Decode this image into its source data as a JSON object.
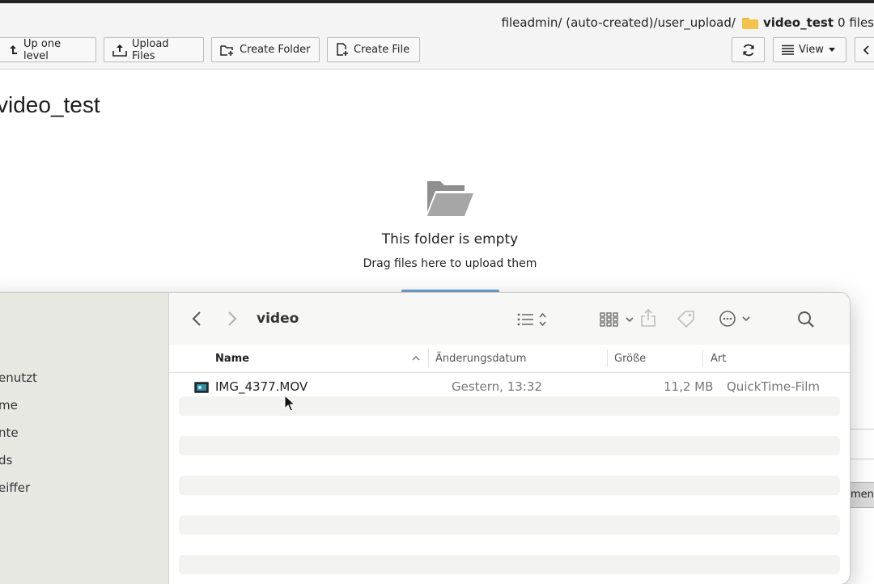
{
  "breadcrumb": {
    "path_prefix": "fileadmin/ (auto-created)/user_upload/",
    "current_folder": "video_test",
    "file_count": "0 files"
  },
  "toolbar": {
    "up_label": "Up one level",
    "upload_label": "Upload Files",
    "create_folder_label": "Create Folder",
    "create_file_label": "Create File",
    "view_label": "View"
  },
  "page": {
    "title": "video_test",
    "empty_title": "This folder is empty",
    "empty_subtitle": "Drag files here to upload them",
    "partial_button_text": "ment"
  },
  "finder": {
    "folder_title": "video",
    "sidebar_items": [
      "enutzt",
      "me",
      "nte",
      "ds",
      "eiffer"
    ],
    "columns": {
      "name": "Name",
      "date": "Änderungsdatum",
      "size": "Größe",
      "kind": "Art"
    },
    "files": [
      {
        "name": "IMG_4377.MOV",
        "date": "Gestern, 13:32",
        "size": "11,2 MB",
        "kind": "QuickTime-Film"
      }
    ]
  },
  "colors": {
    "accent_upload_bar": "#6f9fd0",
    "folder_yellow": "#f4c24f",
    "finder_sidebar": "#e8e8e3"
  }
}
